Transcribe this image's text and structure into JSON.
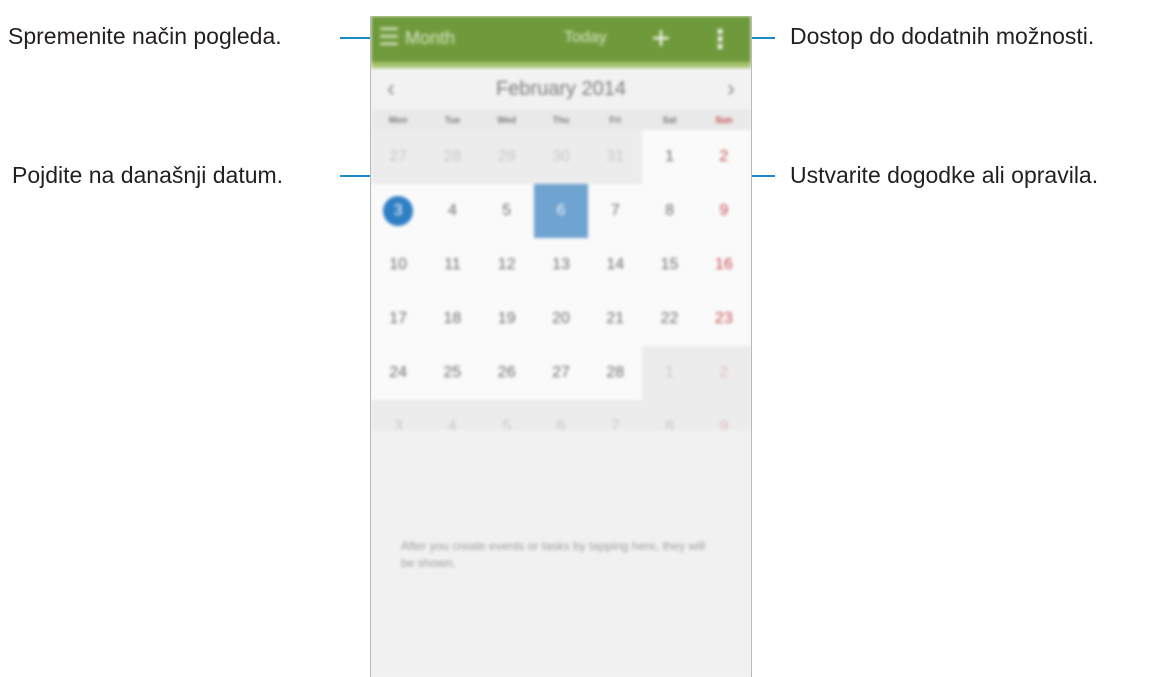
{
  "callouts": {
    "view_mode": "Spremenite način pogleda.",
    "more_options": "Dostop do dodatnih možnosti.",
    "today": "Pojdite na današnji datum.",
    "create": "Ustvarite dogodke ali opravila."
  },
  "action_bar": {
    "menu_icon": "hamburger-icon",
    "view_label": "Month",
    "today_label": "Today",
    "add_icon": "plus-icon",
    "more_icon": "vertical-dots-icon",
    "color": "#6f9a3b"
  },
  "month_bar": {
    "prev_icon": "chevron-left-icon",
    "next_icon": "chevron-right-icon",
    "label": "February 2014"
  },
  "weekdays": [
    "Mon",
    "Tue",
    "Wed",
    "Thu",
    "Fri",
    "Sat",
    "Sun"
  ],
  "weeks": [
    [
      {
        "d": "27",
        "other": true
      },
      {
        "d": "28",
        "other": true
      },
      {
        "d": "29",
        "other": true
      },
      {
        "d": "30",
        "other": true
      },
      {
        "d": "31",
        "other": true
      },
      {
        "d": "1"
      },
      {
        "d": "2"
      }
    ],
    [
      {
        "d": "3",
        "today": true
      },
      {
        "d": "4"
      },
      {
        "d": "5"
      },
      {
        "d": "6",
        "selected": true
      },
      {
        "d": "7"
      },
      {
        "d": "8"
      },
      {
        "d": "9"
      }
    ],
    [
      {
        "d": "10"
      },
      {
        "d": "11"
      },
      {
        "d": "12"
      },
      {
        "d": "13"
      },
      {
        "d": "14"
      },
      {
        "d": "15"
      },
      {
        "d": "16"
      }
    ],
    [
      {
        "d": "17"
      },
      {
        "d": "18"
      },
      {
        "d": "19"
      },
      {
        "d": "20"
      },
      {
        "d": "21"
      },
      {
        "d": "22"
      },
      {
        "d": "23"
      }
    ],
    [
      {
        "d": "24"
      },
      {
        "d": "25"
      },
      {
        "d": "26"
      },
      {
        "d": "27"
      },
      {
        "d": "28"
      },
      {
        "d": "1",
        "other": true
      },
      {
        "d": "2",
        "other": true
      }
    ],
    [
      {
        "d": "3",
        "other": true
      },
      {
        "d": "4",
        "other": true
      },
      {
        "d": "5",
        "other": true
      },
      {
        "d": "6",
        "other": true
      },
      {
        "d": "7",
        "other": true
      },
      {
        "d": "8",
        "other": true
      },
      {
        "d": "9",
        "other": true
      }
    ]
  ],
  "hint": "After you create events or tasks by tapping here, they will be shown.",
  "colors": {
    "callout_line": "#1b89c6",
    "today_circle": "#2f7fc4",
    "selected_cell": "#6fa3d0",
    "sunday": "#c2474c"
  }
}
